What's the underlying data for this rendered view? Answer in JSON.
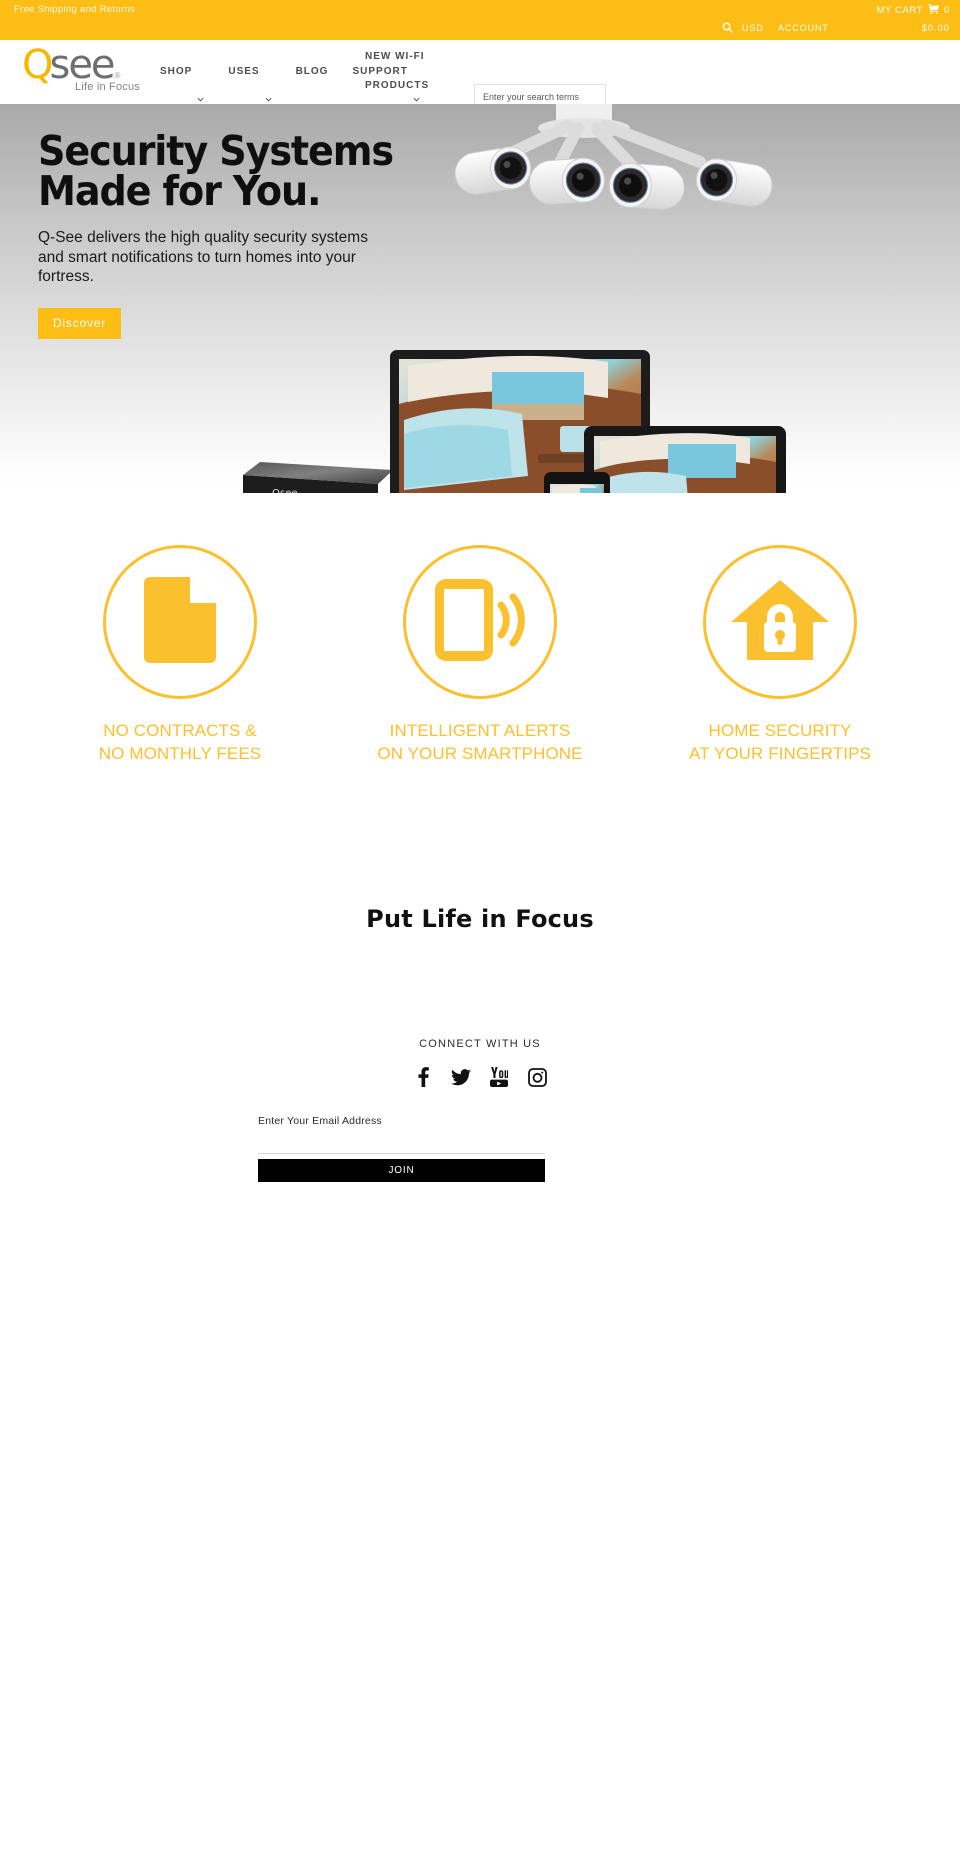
{
  "topbar": {
    "shipping": "Free Shipping and Returns",
    "my_cart": "MY CART",
    "cart_count": "0",
    "search_icon": "search-icon",
    "currency": "USD",
    "account": "ACCOUNT",
    "cart_total": "$0.00",
    "background": "#fcbe14"
  },
  "header": {
    "logo": {
      "q": "Q",
      "see": "see",
      "registered": "®",
      "tagline": "Life in Focus",
      "q_color": "#f5b800",
      "see_color": "#6d6e71"
    },
    "nav": [
      {
        "label": "SHOP",
        "has_caret": true
      },
      {
        "label": "USES",
        "has_caret": true
      },
      {
        "label": "BLOG",
        "has_caret": false
      },
      {
        "label": "SUPPORT",
        "has_caret": true
      }
    ],
    "promo_nav": {
      "line1": "NEW WI-FI",
      "line2": "PRODUCTS"
    },
    "search": {
      "placeholder": "Enter your search terms",
      "value": ""
    }
  },
  "hero": {
    "title_line1": "Security Systems",
    "title_line2": "Made for You.",
    "subtitle": "Q-See delivers the high quality security systems and smart notifications to turn homes into your fortress.",
    "cta_label": "Discover",
    "cta_color": "#fcbe14"
  },
  "features": {
    "accent_color": "#fbc02d",
    "items": [
      {
        "icon": "document-icon",
        "line1": "NO CONTRACTS &",
        "line2": "NO MONTHLY FEES"
      },
      {
        "icon": "smartphone-signal-icon",
        "line1": "INTELLIGENT ALERTS",
        "line2": "ON YOUR SMARTPHONE"
      },
      {
        "icon": "house-lock-icon",
        "line1": "HOME SECURITY",
        "line2": "AT YOUR FINGERTIPS"
      }
    ]
  },
  "focus_section": {
    "heading": "Put Life in Focus"
  },
  "footer": {
    "connect_title": "CONNECT WITH US",
    "social": [
      {
        "icon": "facebook-icon",
        "name": "Facebook"
      },
      {
        "icon": "twitter-icon",
        "name": "Twitter"
      },
      {
        "icon": "youtube-icon",
        "name": "YouTube"
      },
      {
        "icon": "instagram-icon",
        "name": "Instagram"
      }
    ],
    "email_label": "Enter Your Email Address",
    "email_placeholder": "",
    "email_value": "",
    "join_label": "JOIN"
  }
}
